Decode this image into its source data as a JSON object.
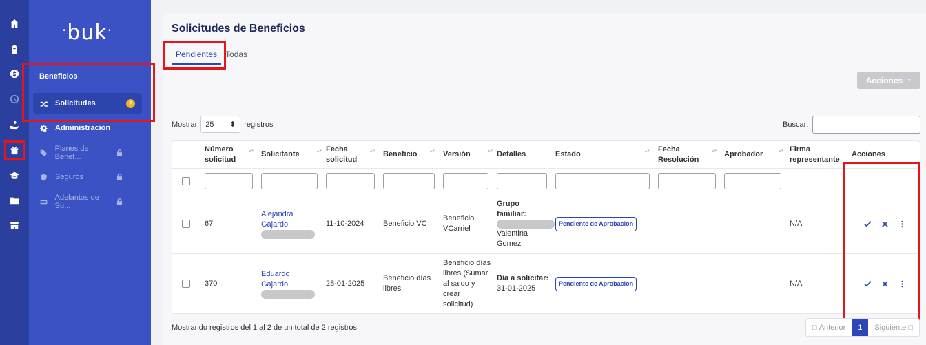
{
  "app": {
    "logo": "buk"
  },
  "sidebar": {
    "section_title": "Beneficios",
    "items": [
      {
        "label": "Solicitudes",
        "badge": "2"
      },
      {
        "label": "Administración"
      },
      {
        "label": "Planes de Benef..."
      },
      {
        "label": "Seguros"
      },
      {
        "label": "Adelantos de Su..."
      }
    ]
  },
  "page": {
    "title": "Solicitudes de Beneficios",
    "tabs": [
      "Pendientes",
      "Todas"
    ],
    "actions_button": "Acciones",
    "length": {
      "prefix": "Mostrar",
      "value": "25",
      "suffix": "registros"
    },
    "search_label": "Buscar:"
  },
  "table": {
    "headers": {
      "numero": "Número solicitud",
      "solicitante": "Solicitante",
      "fecha": "Fecha solicitud",
      "beneficio": "Beneficio",
      "version": "Versión",
      "detalles": "Detalles",
      "estado": "Estado",
      "fecha_res": "Fecha Resolución",
      "aprobador": "Aprobador",
      "firma": "Firma representante",
      "acciones": "Acciones"
    },
    "rows": [
      {
        "numero": "67",
        "solicitante": "Alejandra Gajardo",
        "fecha": "11-10-2024",
        "beneficio": "Beneficio VC",
        "version": "Beneficio VCarriel",
        "detalle_label": "Grupo familiar:",
        "detalle_value": "Valentina Gomez",
        "estado": "Pendiente de Aprobación",
        "firma": "N/A"
      },
      {
        "numero": "370",
        "solicitante": "Eduardo Gajardo",
        "fecha": "28-01-2025",
        "beneficio": "Beneficio días libres",
        "version": "Beneficio días libres (Sumar al saldo y crear solicitud)",
        "detalle_label": "Día a solicitar:",
        "detalle_value": "31-01-2025",
        "estado": "Pendiente de Aprobación",
        "firma": "N/A"
      }
    ]
  },
  "footer": {
    "info": "Mostrando registros del 1 al 2 de un total de 2 registros",
    "prev": "Anterior",
    "page": "1",
    "next": "Siguiente",
    "prev_icon": "□",
    "next_icon": "□"
  },
  "colors": {
    "rail": "#2b3f9e",
    "sidebar": "#3a52c4",
    "accent": "#2d45b7",
    "highlight": "#e3161c",
    "badge": "#f0b429"
  }
}
